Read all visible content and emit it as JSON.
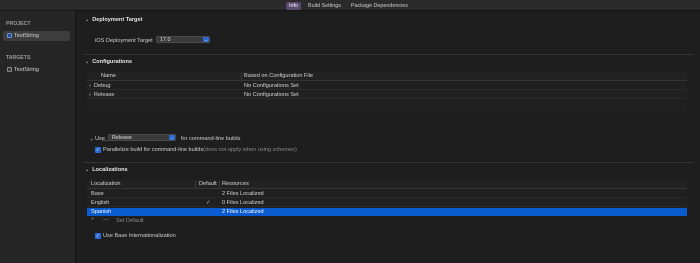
{
  "tabs": [
    {
      "label": "Info"
    },
    {
      "label": "Build Settings"
    },
    {
      "label": "Package Dependencies"
    }
  ],
  "sidebar": {
    "project_header": "PROJECT",
    "project_item": "TestString",
    "targets_header": "TARGETS",
    "target_item": "TestString"
  },
  "deployment": {
    "title": "Deployment Target",
    "label": "iOS Deployment Target",
    "value": "17.0"
  },
  "configurations": {
    "title": "Configurations",
    "headers": {
      "name": "Name",
      "based_on": "Based on Configuration File"
    },
    "rows": [
      {
        "name": "Debug",
        "based_on": "No Configurations Set"
      },
      {
        "name": "Release",
        "based_on": "No Configurations Set"
      }
    ],
    "use_label": "Use",
    "use_value": "Release",
    "use_suffix": "for command-line builds",
    "parallelize_label": "Parallelize build for command-line builds",
    "parallelize_note": "(does not apply when using schemes)"
  },
  "localizations": {
    "title": "Localizations",
    "headers": {
      "localization": "Localization",
      "default": "Default",
      "resources": "Resources"
    },
    "rows": [
      {
        "localization": "Base",
        "default": "",
        "resources": "2 Files Localized"
      },
      {
        "localization": "English",
        "default": "✓",
        "resources": "0 Files Localized"
      },
      {
        "localization": "Spanish",
        "default": "",
        "resources": "2 Files Localized"
      }
    ],
    "set_default": "Set Default",
    "base_intl_label": "Use Base Internationalization"
  },
  "icons": {
    "plus": "+",
    "minus": "—",
    "check": "✓",
    "chevron_down": "⌄",
    "chevron_right": "›"
  }
}
